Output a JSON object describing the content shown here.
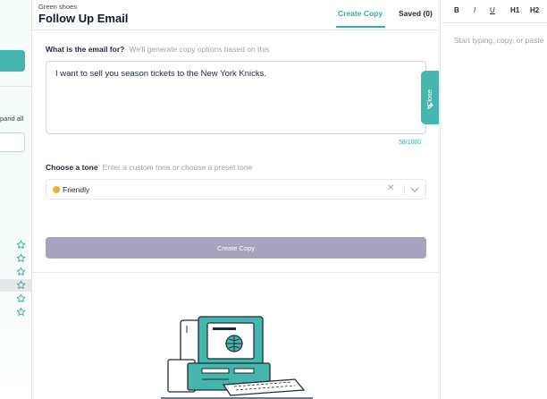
{
  "sidebar": {
    "expand_all_label": "pand all"
  },
  "header": {
    "breadcrumb": "Green shoes",
    "title": "Follow Up Email",
    "tabs": [
      {
        "label": "Create Copy",
        "active": true
      },
      {
        "label": "Saved (0)",
        "active": false
      }
    ]
  },
  "form": {
    "question_label": "What is the email for?",
    "question_hint": "We'll generate copy options based on this",
    "email_value": "I want to sell you season tickets to the New York Knicks.",
    "char_count": "58/1000",
    "close_label": "Close",
    "tone_label": "Choose a tone",
    "tone_hint": "Enter a custom tone or choose a preset tone",
    "tone_value": "Friendly",
    "tone_icon": "emoji-smile-icon",
    "create_button_label": "Create Copy"
  },
  "editor": {
    "toolbar": [
      "B",
      "I",
      "U",
      "H1",
      "H2"
    ],
    "placeholder": "Start typing, copy, or paste"
  },
  "colors": {
    "accent": "#3aa9a0",
    "button_disabled": "#a8a4c0",
    "tone_dot": "#e0b43a"
  }
}
